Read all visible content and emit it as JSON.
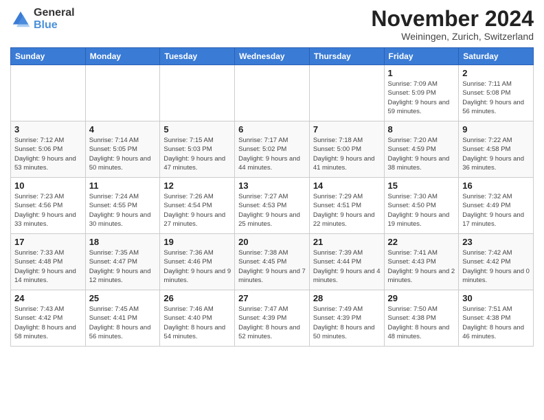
{
  "header": {
    "logo_general": "General",
    "logo_blue": "Blue",
    "month_title": "November 2024",
    "location": "Weiningen, Zurich, Switzerland"
  },
  "weekdays": [
    "Sunday",
    "Monday",
    "Tuesday",
    "Wednesday",
    "Thursday",
    "Friday",
    "Saturday"
  ],
  "weeks": [
    [
      {
        "day": "",
        "info": ""
      },
      {
        "day": "",
        "info": ""
      },
      {
        "day": "",
        "info": ""
      },
      {
        "day": "",
        "info": ""
      },
      {
        "day": "",
        "info": ""
      },
      {
        "day": "1",
        "info": "Sunrise: 7:09 AM\nSunset: 5:09 PM\nDaylight: 9 hours and 59 minutes."
      },
      {
        "day": "2",
        "info": "Sunrise: 7:11 AM\nSunset: 5:08 PM\nDaylight: 9 hours and 56 minutes."
      }
    ],
    [
      {
        "day": "3",
        "info": "Sunrise: 7:12 AM\nSunset: 5:06 PM\nDaylight: 9 hours and 53 minutes."
      },
      {
        "day": "4",
        "info": "Sunrise: 7:14 AM\nSunset: 5:05 PM\nDaylight: 9 hours and 50 minutes."
      },
      {
        "day": "5",
        "info": "Sunrise: 7:15 AM\nSunset: 5:03 PM\nDaylight: 9 hours and 47 minutes."
      },
      {
        "day": "6",
        "info": "Sunrise: 7:17 AM\nSunset: 5:02 PM\nDaylight: 9 hours and 44 minutes."
      },
      {
        "day": "7",
        "info": "Sunrise: 7:18 AM\nSunset: 5:00 PM\nDaylight: 9 hours and 41 minutes."
      },
      {
        "day": "8",
        "info": "Sunrise: 7:20 AM\nSunset: 4:59 PM\nDaylight: 9 hours and 38 minutes."
      },
      {
        "day": "9",
        "info": "Sunrise: 7:22 AM\nSunset: 4:58 PM\nDaylight: 9 hours and 36 minutes."
      }
    ],
    [
      {
        "day": "10",
        "info": "Sunrise: 7:23 AM\nSunset: 4:56 PM\nDaylight: 9 hours and 33 minutes."
      },
      {
        "day": "11",
        "info": "Sunrise: 7:24 AM\nSunset: 4:55 PM\nDaylight: 9 hours and 30 minutes."
      },
      {
        "day": "12",
        "info": "Sunrise: 7:26 AM\nSunset: 4:54 PM\nDaylight: 9 hours and 27 minutes."
      },
      {
        "day": "13",
        "info": "Sunrise: 7:27 AM\nSunset: 4:53 PM\nDaylight: 9 hours and 25 minutes."
      },
      {
        "day": "14",
        "info": "Sunrise: 7:29 AM\nSunset: 4:51 PM\nDaylight: 9 hours and 22 minutes."
      },
      {
        "day": "15",
        "info": "Sunrise: 7:30 AM\nSunset: 4:50 PM\nDaylight: 9 hours and 19 minutes."
      },
      {
        "day": "16",
        "info": "Sunrise: 7:32 AM\nSunset: 4:49 PM\nDaylight: 9 hours and 17 minutes."
      }
    ],
    [
      {
        "day": "17",
        "info": "Sunrise: 7:33 AM\nSunset: 4:48 PM\nDaylight: 9 hours and 14 minutes."
      },
      {
        "day": "18",
        "info": "Sunrise: 7:35 AM\nSunset: 4:47 PM\nDaylight: 9 hours and 12 minutes."
      },
      {
        "day": "19",
        "info": "Sunrise: 7:36 AM\nSunset: 4:46 PM\nDaylight: 9 hours and 9 minutes."
      },
      {
        "day": "20",
        "info": "Sunrise: 7:38 AM\nSunset: 4:45 PM\nDaylight: 9 hours and 7 minutes."
      },
      {
        "day": "21",
        "info": "Sunrise: 7:39 AM\nSunset: 4:44 PM\nDaylight: 9 hours and 4 minutes."
      },
      {
        "day": "22",
        "info": "Sunrise: 7:41 AM\nSunset: 4:43 PM\nDaylight: 9 hours and 2 minutes."
      },
      {
        "day": "23",
        "info": "Sunrise: 7:42 AM\nSunset: 4:42 PM\nDaylight: 9 hours and 0 minutes."
      }
    ],
    [
      {
        "day": "24",
        "info": "Sunrise: 7:43 AM\nSunset: 4:42 PM\nDaylight: 8 hours and 58 minutes."
      },
      {
        "day": "25",
        "info": "Sunrise: 7:45 AM\nSunset: 4:41 PM\nDaylight: 8 hours and 56 minutes."
      },
      {
        "day": "26",
        "info": "Sunrise: 7:46 AM\nSunset: 4:40 PM\nDaylight: 8 hours and 54 minutes."
      },
      {
        "day": "27",
        "info": "Sunrise: 7:47 AM\nSunset: 4:39 PM\nDaylight: 8 hours and 52 minutes."
      },
      {
        "day": "28",
        "info": "Sunrise: 7:49 AM\nSunset: 4:39 PM\nDaylight: 8 hours and 50 minutes."
      },
      {
        "day": "29",
        "info": "Sunrise: 7:50 AM\nSunset: 4:38 PM\nDaylight: 8 hours and 48 minutes."
      },
      {
        "day": "30",
        "info": "Sunrise: 7:51 AM\nSunset: 4:38 PM\nDaylight: 8 hours and 46 minutes."
      }
    ]
  ]
}
